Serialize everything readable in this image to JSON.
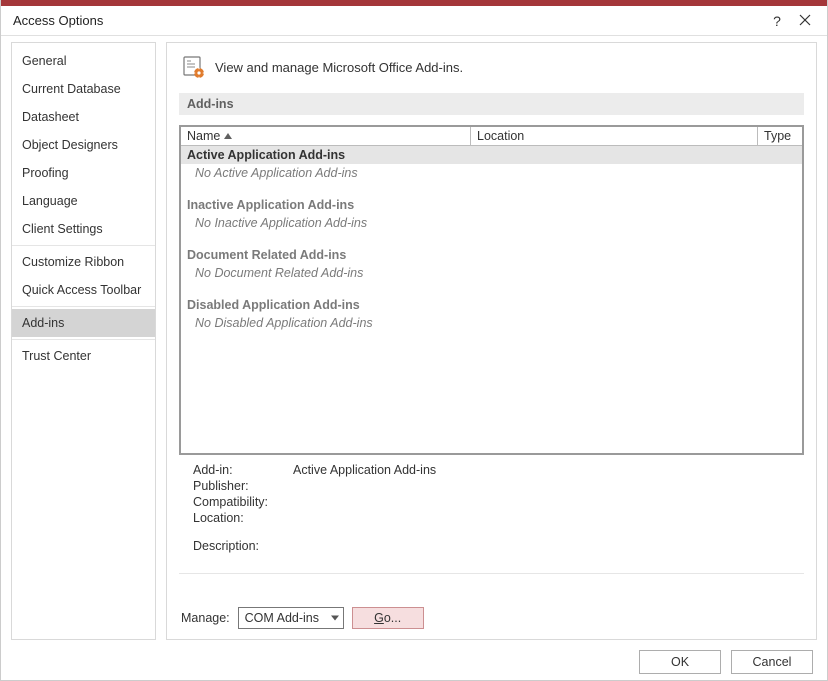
{
  "window": {
    "title": "Access Options"
  },
  "sidebar": {
    "groups": [
      [
        "General",
        "Current Database",
        "Datasheet",
        "Object Designers",
        "Proofing",
        "Language",
        "Client Settings"
      ],
      [
        "Customize Ribbon",
        "Quick Access Toolbar"
      ],
      [
        "Add-ins"
      ],
      [
        "Trust Center"
      ]
    ],
    "items": {
      "0": "General",
      "1": "Current Database",
      "2": "Datasheet",
      "3": "Object Designers",
      "4": "Proofing",
      "5": "Language",
      "6": "Client Settings",
      "7": "Customize Ribbon",
      "8": "Quick Access Toolbar",
      "9": "Add-ins",
      "10": "Trust Center"
    },
    "selected": "Add-ins"
  },
  "main": {
    "heading": "View and manage Microsoft Office Add-ins.",
    "section_label": "Add-ins",
    "columns": {
      "name": "Name",
      "location": "Location",
      "type": "Type"
    },
    "groups": {
      "active": {
        "title": "Active Application Add-ins",
        "empty": "No Active Application Add-ins"
      },
      "inactive": {
        "title": "Inactive Application Add-ins",
        "empty": "No Inactive Application Add-ins"
      },
      "document": {
        "title": "Document Related Add-ins",
        "empty": "No Document Related Add-ins"
      },
      "disabled": {
        "title": "Disabled Application Add-ins",
        "empty": "No Disabled Application Add-ins"
      }
    },
    "details": {
      "labels": {
        "addin": "Add-in:",
        "publisher": "Publisher:",
        "compatibility": "Compatibility:",
        "location": "Location:",
        "description": "Description:"
      },
      "values": {
        "addin": "Active Application Add-ins",
        "publisher": "",
        "compatibility": "",
        "location": "",
        "description": ""
      }
    },
    "manage": {
      "label": "Manage:",
      "selected": "COM Add-ins",
      "go_prefix": "G",
      "go_suffix": "o..."
    }
  },
  "footer": {
    "ok": "OK",
    "cancel": "Cancel"
  }
}
